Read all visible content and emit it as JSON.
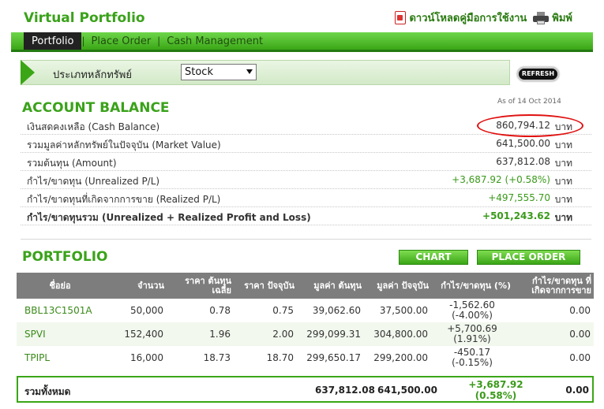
{
  "app": {
    "title": "Virtual Portfolio"
  },
  "top_actions": {
    "download_label": "ดาวน์โหลดคู่มือการใช้งาน",
    "print_label": "พิมพ์"
  },
  "tabs": [
    {
      "label": "Portfolio",
      "active": true
    },
    {
      "label": "Place Order",
      "active": false
    },
    {
      "label": "Cash Management",
      "active": false
    }
  ],
  "filter": {
    "label": "ประเภทหลักทรัพย์",
    "selected": "Stock"
  },
  "refresh_label": "REFRESH",
  "account_balance": {
    "title": "ACCOUNT BALANCE",
    "as_of": "As of 14 Oct 2014",
    "rows": [
      {
        "label": "เงินสดคงเหลือ (Cash Balance)",
        "value": "860,794.12",
        "unit": "บาท"
      },
      {
        "label": "รวมมูลค่าหลักทรัพย์ในปัจจุบัน (Market Value)",
        "value": "641,500.00",
        "unit": "บาท"
      },
      {
        "label": "รวมต้นทุน (Amount)",
        "value": "637,812.08",
        "unit": "บาท"
      },
      {
        "label": "กำไร/ขาดทุน (Unrealized P/L)",
        "value": "+3,687.92 (+0.58%)",
        "unit": "บาท"
      },
      {
        "label": "กำไร/ขาดทุนที่เกิดจากการขาย (Realized P/L)",
        "value": "+497,555.70",
        "unit": "บาท"
      },
      {
        "label": "กำไร/ขาดทุนรวม (Unrealized + Realized Profit and Loss)",
        "value": "+501,243.62",
        "unit": "บาท"
      }
    ]
  },
  "portfolio": {
    "title": "PORTFOLIO",
    "chart_button": "CHART",
    "place_order_button": "PLACE ORDER",
    "columns": [
      "ชื่อย่อ",
      "จำนวน",
      "ราคา ต้นทุนเฉลี่ย",
      "ราคา ปัจจุบัน",
      "มูลค่า ต้นทุน",
      "มูลค่า ปัจจุบัน",
      "กำไร/ขาดทุน (%)",
      "กำไร/ขาดทุน ที่ เกิดจากการขาย"
    ],
    "rows": [
      {
        "symbol": "BBL13C1501A",
        "qty": "50,000",
        "avg_cost": "0.78",
        "price": "0.75",
        "cost_value": "39,062.60",
        "market_value": "37,500.00",
        "pl": "-1,562.60",
        "pl_pct": "(-4.00%)",
        "realized": "0.00"
      },
      {
        "symbol": "SPVI",
        "qty": "152,400",
        "avg_cost": "1.96",
        "price": "2.00",
        "cost_value": "299,099.31",
        "market_value": "304,800.00",
        "pl": "+5,700.69",
        "pl_pct": "(1.91%)",
        "realized": "0.00"
      },
      {
        "symbol": "TPIPL",
        "qty": "16,000",
        "avg_cost": "18.73",
        "price": "18.70",
        "cost_value": "299,650.17",
        "market_value": "299,200.00",
        "pl": "-450.17",
        "pl_pct": "(-0.15%)",
        "realized": "0.00"
      }
    ],
    "total": {
      "label": "รวมทั้งหมด",
      "cost_value": "637,812.08",
      "market_value": "641,500.00",
      "pl": "+3,687.92",
      "pl_pct": "(0.58%)",
      "realized": "0.00"
    }
  },
  "colors": {
    "brand_green": "#3aa21a",
    "negative": "#c01818",
    "positive": "#3a9a1a"
  }
}
